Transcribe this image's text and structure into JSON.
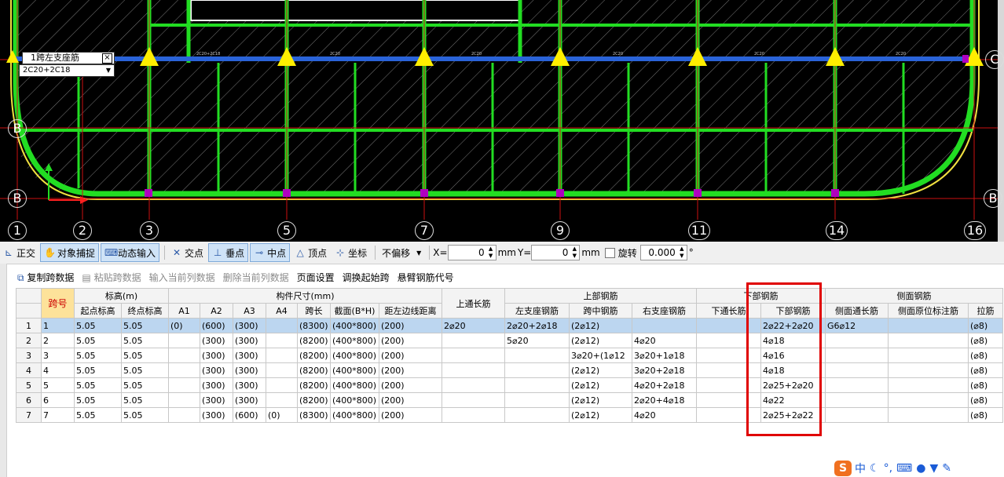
{
  "cad": {
    "axis_numbers": [
      "1",
      "2",
      "3",
      "5",
      "7",
      "9",
      "11",
      "14",
      "16"
    ],
    "row_letters": [
      "C",
      "B",
      "B",
      "B"
    ],
    "span_label": "1跨左支座筋",
    "span_combo": "2C20+2C18",
    "colors": {
      "beam": "#22dd22",
      "rebar": "#2a63d8",
      "support": "#ffee00",
      "grid": "#d11",
      "hatch": "#8a8a8a"
    }
  },
  "toolbar1": {
    "ortho": "正交",
    "snap": "对象捕捉",
    "dynamic": "动态输入",
    "intersect": "交点",
    "perp": "垂点",
    "mid": "中点",
    "vertex": "顶点",
    "coord": "坐标",
    "offset": "不偏移",
    "x_label": "X=",
    "x_value": "0",
    "mm1": "mm",
    "y_label": "Y=",
    "y_value": "0",
    "mm2": "mm",
    "rotate": "旋转",
    "rotate_value": "0.000",
    "deg": "°"
  },
  "toolbar2": {
    "copy": "复制跨数据",
    "paste": "粘贴跨数据",
    "input_col": "输入当前列数据",
    "delete_col": "删除当前列数据",
    "page_setup": "页面设置",
    "swap_start": "调换起始跨",
    "cantilever": "悬臂钢筋代号"
  },
  "table": {
    "group_headers": {
      "span_no": "跨号",
      "elevation": "标高(m)",
      "dims": "构件尺寸(mm)",
      "top_long": "上通长筋",
      "top_rebar": "上部钢筋",
      "bottom_rebar": "下部钢筋",
      "side_rebar": "侧面钢筋"
    },
    "sub_headers": {
      "start_el": "起点标高",
      "end_el": "终点标高",
      "a1": "A1",
      "a2": "A2",
      "a3": "A3",
      "a4": "A4",
      "span_len": "跨长",
      "section": "截面(B*H)",
      "dist": "距左边线距离",
      "left_sup": "左支座钢筋",
      "mid": "跨中钢筋",
      "right_sup": "右支座钢筋",
      "bot_long": "下通长筋",
      "bot": "下部钢筋",
      "side_long": "侧面通长筋",
      "side_orig": "侧面原位标注筋",
      "tie": "拉筋"
    },
    "rows": [
      {
        "n": "1",
        "span": "1",
        "s": "5.05",
        "e": "5.05",
        "a1": "(0)",
        "a2": "(600)",
        "a3": "(300)",
        "a4": "",
        "len": "(8300)",
        "sec": "(400*800)",
        "d": "(200)",
        "top": "2⌀20",
        "ls": "2⌀20+2⌀18",
        "mid": "(2⌀12)",
        "rs": "",
        "bl": "",
        "bot": "2⌀22+2⌀20",
        "sl": "G6⌀12",
        "so": "",
        "tie": "(⌀8)"
      },
      {
        "n": "2",
        "span": "2",
        "s": "5.05",
        "e": "5.05",
        "a1": "",
        "a2": "(300)",
        "a3": "(300)",
        "a4": "",
        "len": "(8200)",
        "sec": "(400*800)",
        "d": "(200)",
        "top": "",
        "ls": "5⌀20",
        "mid": "(2⌀12)",
        "rs": "4⌀20",
        "bl": "",
        "bot": "4⌀18",
        "sl": "",
        "so": "",
        "tie": "(⌀8)"
      },
      {
        "n": "3",
        "span": "3",
        "s": "5.05",
        "e": "5.05",
        "a1": "",
        "a2": "(300)",
        "a3": "(300)",
        "a4": "",
        "len": "(8200)",
        "sec": "(400*800)",
        "d": "(200)",
        "top": "",
        "ls": "",
        "mid": "3⌀20+(1⌀12",
        "rs": "3⌀20+1⌀18",
        "bl": "",
        "bot": "4⌀16",
        "sl": "",
        "so": "",
        "tie": "(⌀8)"
      },
      {
        "n": "4",
        "span": "4",
        "s": "5.05",
        "e": "5.05",
        "a1": "",
        "a2": "(300)",
        "a3": "(300)",
        "a4": "",
        "len": "(8200)",
        "sec": "(400*800)",
        "d": "(200)",
        "top": "",
        "ls": "",
        "mid": "(2⌀12)",
        "rs": "3⌀20+2⌀18",
        "bl": "",
        "bot": "4⌀18",
        "sl": "",
        "so": "",
        "tie": "(⌀8)"
      },
      {
        "n": "5",
        "span": "5",
        "s": "5.05",
        "e": "5.05",
        "a1": "",
        "a2": "(300)",
        "a3": "(300)",
        "a4": "",
        "len": "(8200)",
        "sec": "(400*800)",
        "d": "(200)",
        "top": "",
        "ls": "",
        "mid": "(2⌀12)",
        "rs": "4⌀20+2⌀18",
        "bl": "",
        "bot": "2⌀25+2⌀20",
        "sl": "",
        "so": "",
        "tie": "(⌀8)"
      },
      {
        "n": "6",
        "span": "6",
        "s": "5.05",
        "e": "5.05",
        "a1": "",
        "a2": "(300)",
        "a3": "(300)",
        "a4": "",
        "len": "(8200)",
        "sec": "(400*800)",
        "d": "(200)",
        "top": "",
        "ls": "",
        "mid": "(2⌀12)",
        "rs": "2⌀20+4⌀18",
        "bl": "",
        "bot": "4⌀22",
        "sl": "",
        "so": "",
        "tie": "(⌀8)"
      },
      {
        "n": "7",
        "span": "7",
        "s": "5.05",
        "e": "5.05",
        "a1": "",
        "a2": "(300)",
        "a3": "(600)",
        "a4": "(0)",
        "len": "(8300)",
        "sec": "(400*800)",
        "d": "(200)",
        "top": "",
        "ls": "",
        "mid": "(2⌀12)",
        "rs": "4⌀20",
        "bl": "",
        "bot": "2⌀25+2⌀22",
        "sl": "",
        "so": "",
        "tie": "(⌀8)"
      }
    ]
  },
  "ime": {
    "brand": "S",
    "lang": "中"
  }
}
